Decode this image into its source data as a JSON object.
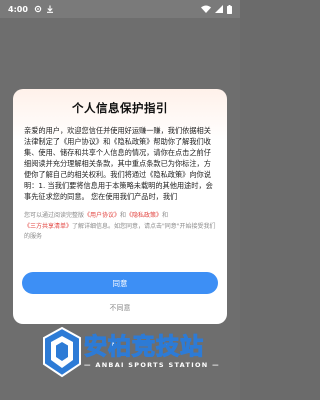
{
  "status_bar": {
    "time": "4:00"
  },
  "dialog": {
    "title": "个人信息保护指引",
    "body": "亲爱的用户，欢迎您信任并使用好运赚一赚，我们依据相关法律制定了《用户协议》和《隐私政策》帮助你了解我们收集、使用、储存和共享个人信息的情况，请你在点击之前仔细阅读并充分理解相关条款，其中重点条款已为你标注，方便你了解自己的相关权利。我们将通过《隐私政策》向你说明：1. 当我们要将信息用于本策略未载明的其他用途时，会事先征求您的同意。 您在使用我们产品时，我们",
    "notice_prefix": "您可以通过阅读完整版",
    "link_user_agreement": "《用户协议》",
    "notice_and": "和",
    "link_privacy_policy": "《隐私政策》",
    "notice_and2": "和",
    "link_third_party": "《三方共享清单》",
    "notice_suffix": "了解详细信息。如您同意，请点击\"同意\"开始接受我们的服务",
    "agree_label": "同意",
    "disagree_label": "不同意"
  },
  "watermark": {
    "title": "安柏竞技站",
    "subtitle": "— ANBAI SPORTS STATION —"
  },
  "colors": {
    "accent": "#3d8ff5",
    "link": "#e2433f"
  }
}
